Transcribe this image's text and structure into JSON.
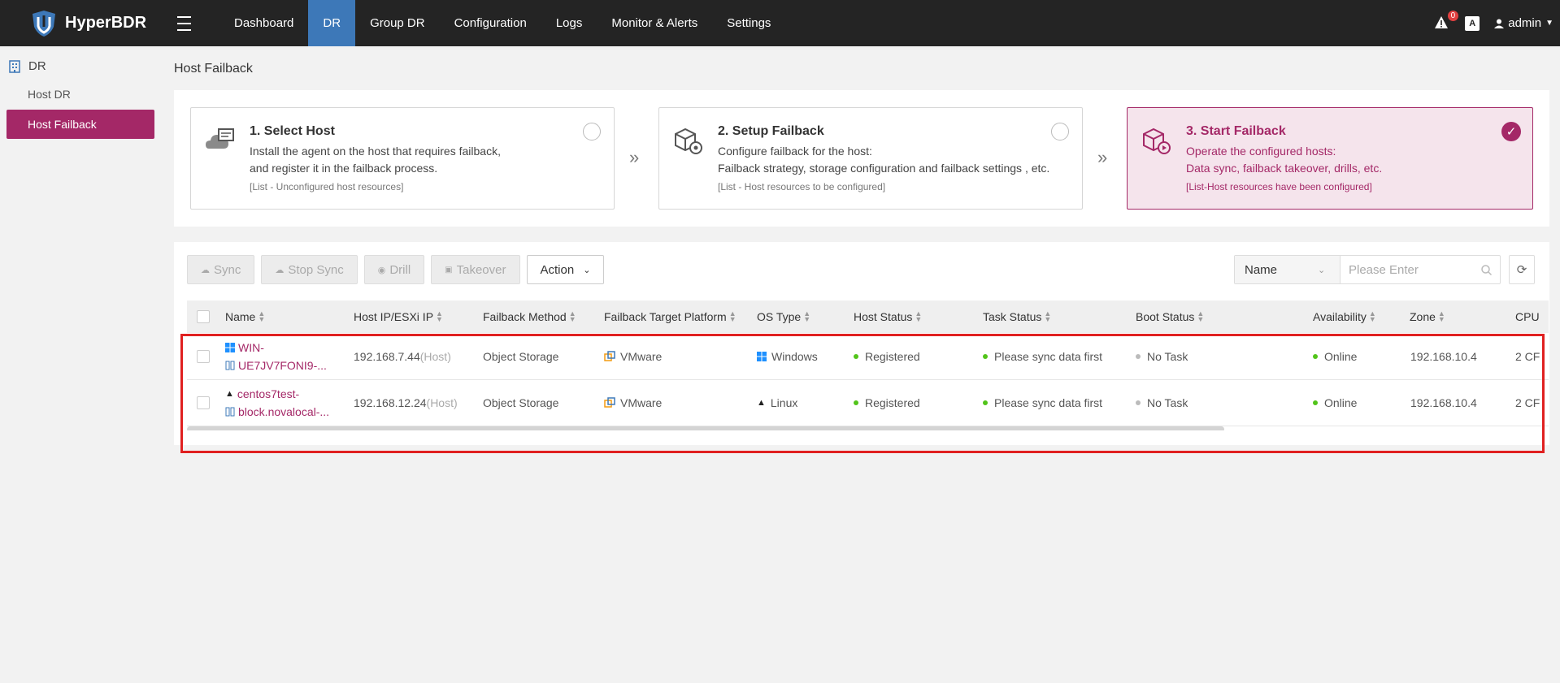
{
  "brand": {
    "name": "HyperBDR"
  },
  "nav": {
    "items": [
      {
        "label": "Dashboard",
        "active": false
      },
      {
        "label": "DR",
        "active": true
      },
      {
        "label": "Group DR",
        "active": false
      },
      {
        "label": "Configuration",
        "active": false
      },
      {
        "label": "Logs",
        "active": false
      },
      {
        "label": "Monitor & Alerts",
        "active": false
      },
      {
        "label": "Settings",
        "active": false
      }
    ]
  },
  "header": {
    "alert_count": "0",
    "lang_label": "A",
    "user": "admin"
  },
  "sidebar": {
    "group": "DR",
    "items": [
      {
        "label": "Host DR"
      },
      {
        "label": "Host Failback"
      }
    ]
  },
  "page": {
    "title": "Host Failback"
  },
  "steps": [
    {
      "title": "1. Select Host",
      "desc1": "Install the agent on the host that requires failback,",
      "desc2": "and register it in the failback process.",
      "note": "[List - Unconfigured host resources]"
    },
    {
      "title": "2. Setup Failback",
      "desc1": "Configure failback for the host:",
      "desc2": "Failback strategy, storage configuration and failback settings , etc.",
      "note": "[List - Host resources to be configured]"
    },
    {
      "title": "3. Start Failback",
      "desc1": "Operate the configured hosts:",
      "desc2": "Data sync, failback takeover, drills, etc.",
      "note": "[List-Host resources have been configured]"
    }
  ],
  "toolbar": {
    "sync": "Sync",
    "stop_sync": "Stop Sync",
    "drill": "Drill",
    "takeover": "Takeover",
    "action": "Action"
  },
  "search": {
    "field": "Name",
    "placeholder": "Please Enter"
  },
  "table": {
    "columns": [
      "Name",
      "Host IP/ESXi IP",
      "Failback Method",
      "Failback Target Platform",
      "OS Type",
      "Host Status",
      "Task Status",
      "Boot Status",
      "Availability",
      "Zone",
      "CPU"
    ],
    "rows": [
      {
        "name1": "WIN-",
        "name2": "UE7JV7FONI9-...",
        "ip": "192.168.7.44",
        "ip_suffix": "(Host)",
        "method": "Object Storage",
        "platform": "VMware",
        "os": "Windows",
        "host_status": "Registered",
        "task_status": "Please sync data first",
        "boot_status": "No Task",
        "availability": "Online",
        "zone": "192.168.10.4",
        "cpu": "2 CF"
      },
      {
        "name1": "centos7test-",
        "name2": "block.novalocal-...",
        "ip": "192.168.12.24",
        "ip_suffix": "(Host)",
        "method": "Object Storage",
        "platform": "VMware",
        "os": "Linux",
        "host_status": "Registered",
        "task_status": "Please sync data first",
        "boot_status": "No Task",
        "availability": "Online",
        "zone": "192.168.10.4",
        "cpu": "2 CF"
      }
    ]
  },
  "colors": {
    "brand": "#a42867",
    "nav_active": "#3d78b8",
    "topbar": "#242424",
    "online": "#52c41a",
    "highlight": "#e02020"
  }
}
